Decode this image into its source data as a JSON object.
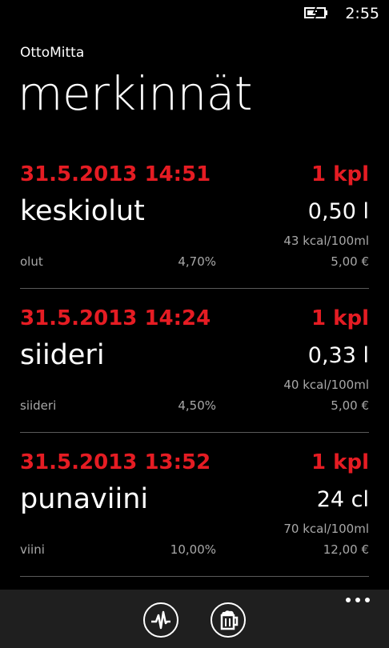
{
  "status": {
    "time": "2:55"
  },
  "app": {
    "name": "OttoMitta",
    "page_title": "merkinnät"
  },
  "entries": [
    {
      "datetime": "31.5.2013 14:51",
      "quantity": "1 kpl",
      "name": "keskiolut",
      "volume": "0,50 l",
      "energy": "43 kcal/100ml",
      "category": "olut",
      "abv": "4,70%",
      "price": "5,00 €"
    },
    {
      "datetime": "31.5.2013 14:24",
      "quantity": "1 kpl",
      "name": "siideri",
      "volume": "0,33 l",
      "energy": "40 kcal/100ml",
      "category": "siideri",
      "abv": "4,50%",
      "price": "5,00 €"
    },
    {
      "datetime": "31.5.2013 13:52",
      "quantity": "1 kpl",
      "name": "punaviini",
      "volume": "24 cl",
      "energy": "70 kcal/100ml",
      "category": "viini",
      "abv": "10,00%",
      "price": "12,00 €"
    }
  ],
  "app_bar": {
    "buttons": [
      "pulse-chart-icon",
      "beer-mug-icon"
    ],
    "more": "ellipsis-icon"
  },
  "colors": {
    "accent": "#e51c23",
    "background": "#000000",
    "secondary_text": "#a8a8a8",
    "app_bar": "#1f1f1f"
  }
}
